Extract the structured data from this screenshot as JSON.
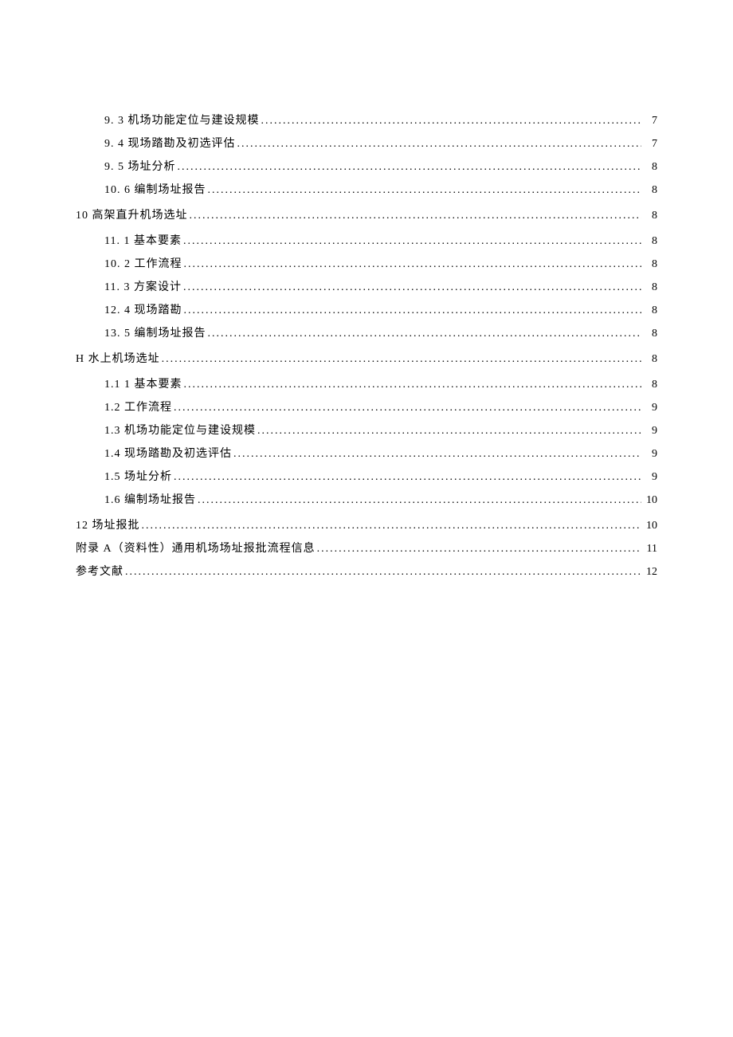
{
  "toc": [
    {
      "level": 2,
      "label": "9.  3 机场功能定位与建设规模",
      "page": "7"
    },
    {
      "level": 2,
      "label": "9.  4 现场踏勘及初选评估",
      "page": "7"
    },
    {
      "level": 2,
      "label": "9.  5 场址分析",
      "page": "8"
    },
    {
      "level": 2,
      "label": "10. 6 编制场址报告",
      "page": "8"
    },
    {
      "level": 1,
      "gap": true,
      "label": "10 高架直升机场选址",
      "page": "8"
    },
    {
      "level": 2,
      "gap": true,
      "label": "11.  1 基本要素",
      "page": "8"
    },
    {
      "level": 2,
      "label": "10.  2 工作流程",
      "page": "8"
    },
    {
      "level": 2,
      "label": "11.  3 方案设计",
      "page": "8"
    },
    {
      "level": 2,
      "label": "12.  4 现场踏勘",
      "page": "8"
    },
    {
      "level": 2,
      "label": "13.  5 编制场址报告",
      "page": "8"
    },
    {
      "level": 1,
      "gap": true,
      "label": "H 水上机场选址",
      "page": "8"
    },
    {
      "level": 2,
      "gap": true,
      "label": "1.1  1 基本要素",
      "page": "8"
    },
    {
      "level": 2,
      "label": "1.2    工作流程",
      "page": "9"
    },
    {
      "level": 2,
      "label": "1.3    机场功能定位与建设规模",
      "page": "9"
    },
    {
      "level": 2,
      "label": "1.4    现场踏勘及初选评估",
      "page": "9"
    },
    {
      "level": 2,
      "label": "1.5    场址分析",
      "page": "9"
    },
    {
      "level": 2,
      "label": "1.6    编制场址报告",
      "page": "10"
    },
    {
      "level": 1,
      "gap": true,
      "label": "12 场址报批",
      "page": "10"
    },
    {
      "level": 1,
      "label": "附录 A（资料性）通用机场场址报批流程信息",
      "page": "11"
    },
    {
      "level": 1,
      "label": "参考文献",
      "page": "12"
    }
  ]
}
